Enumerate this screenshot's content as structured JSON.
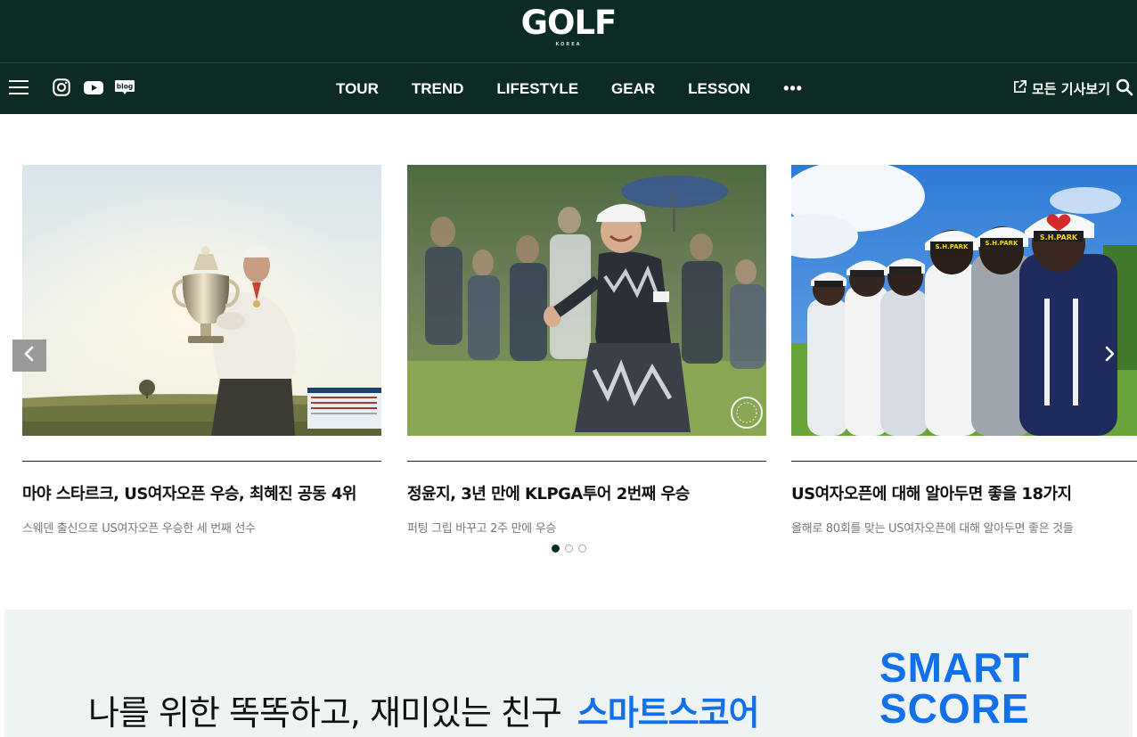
{
  "header": {
    "logo": "GOLF",
    "logo_sub": "KOREA",
    "nav": [
      "TOUR",
      "TREND",
      "LIFESTYLE",
      "GEAR",
      "LESSON",
      "•••"
    ],
    "all_articles_label": "모든 기사보기",
    "social_icons": [
      "instagram-icon",
      "youtube-icon",
      "blog-icon"
    ],
    "blog_icon_text": "blog"
  },
  "colors": {
    "header_bg": "#0c2b24",
    "accent_blue": "#1270ea",
    "banner_bg": "#eef3f3"
  },
  "carousel": {
    "cards": [
      {
        "title": "마야 스타르크, US여자오픈 우승, 최혜진 공동 4위",
        "subtitle": "스웨덴 출신으로 US여자오픈 우승한 세 번째 선수"
      },
      {
        "title": "정윤지, 3년 만에 KLPGA투어 2번째 우승",
        "subtitle": "퍼팅 그립 바꾸고 2주 만에 우승"
      },
      {
        "title": "US여자오픈에 대해 알아두면 좋을 18가지",
        "subtitle": "올해로 80회를 맞는 US여자오픈에 대해 알아두면 좋은 것들"
      }
    ],
    "page_count": 3,
    "active_page": 1
  },
  "banner": {
    "tagline": "나를 위한 똑똑하고, 재미있는 친구",
    "brand_ko": "스마트스코어",
    "brand_en_line1": "SMART",
    "brand_en_line2": "SCORE"
  }
}
